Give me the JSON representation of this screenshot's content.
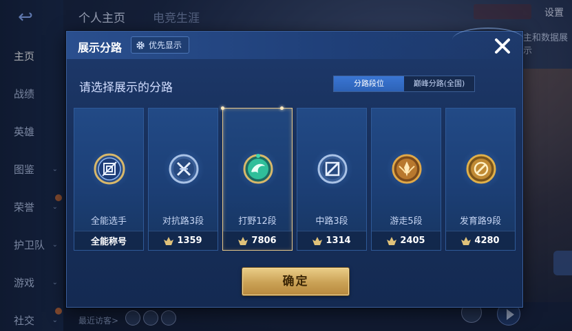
{
  "background": {
    "back_icon": "back-arrow-icon",
    "tabs": [
      {
        "label": "个人主页"
      },
      {
        "label": "电竞生涯"
      }
    ],
    "settings_label": "设置",
    "right_partial_text": "主和数据展示",
    "sidebar": [
      {
        "label": "主页"
      },
      {
        "label": "战绩"
      },
      {
        "label": "英雄"
      },
      {
        "label": "图鉴"
      },
      {
        "label": "荣誉"
      },
      {
        "label": "护卫队"
      },
      {
        "label": "游戏"
      },
      {
        "label": "社交"
      }
    ],
    "visitors_label": "最近访客>"
  },
  "modal": {
    "title": "展示分路",
    "priority_button": "优先显示",
    "close_icon": "close-icon",
    "subtitle": "请选择展示的分路",
    "toggle": {
      "options": [
        "分路段位",
        "巅峰分路(全国)"
      ],
      "selected_index": 0
    },
    "lanes": [
      {
        "name": "全能选手",
        "footer": "全能称号",
        "has_icon": false,
        "emblem": "all-round-emblem-icon",
        "emblem_color": "#d8b86a"
      },
      {
        "name": "对抗路3段",
        "footer": "1359",
        "has_icon": true,
        "emblem": "clash-lane-emblem-icon",
        "emblem_color": "#a9c2e6"
      },
      {
        "name": "打野12段",
        "footer": "7806",
        "has_icon": true,
        "emblem": "jungle-emblem-icon",
        "emblem_color": "#2fbf9a",
        "selected": true
      },
      {
        "name": "中路3段",
        "footer": "1314",
        "has_icon": true,
        "emblem": "mid-lane-emblem-icon",
        "emblem_color": "#a9c2e6"
      },
      {
        "name": "游走5段",
        "footer": "2405",
        "has_icon": true,
        "emblem": "roam-emblem-icon",
        "emblem_color": "#e0a848"
      },
      {
        "name": "发育路9段",
        "footer": "4280",
        "has_icon": true,
        "emblem": "farm-lane-emblem-icon",
        "emblem_color": "#e0b04a"
      }
    ],
    "confirm_label": "确定"
  }
}
